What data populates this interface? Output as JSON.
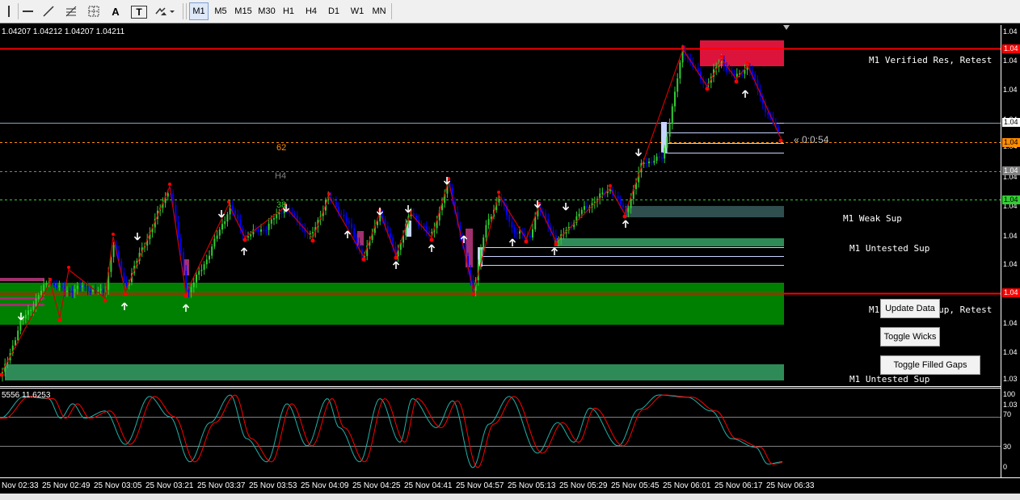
{
  "toolbar": {
    "tools": [
      {
        "icon": "cursor-icon",
        "glyph": "┃"
      },
      {
        "icon": "horizontal-line-icon",
        "glyph": "—"
      },
      {
        "icon": "trendline-icon",
        "glyph": "╱"
      },
      {
        "icon": "fibonacci-icon",
        "glyph": "≡"
      },
      {
        "icon": "grid-icon",
        "glyph": "░"
      },
      {
        "icon": "text-icon",
        "glyph": "A"
      },
      {
        "icon": "text-label-icon",
        "glyph": "T"
      },
      {
        "icon": "arrows-dropdown-icon",
        "glyph": "⤧"
      }
    ],
    "timeframes": [
      "M1",
      "M5",
      "M15",
      "M30",
      "H1",
      "H4",
      "D1",
      "W1",
      "MN"
    ],
    "active_timeframe": "M1"
  },
  "chart": {
    "ohlc_text": "1.04207 1.04212 1.04207 1.04211",
    "countdown": "« 0:0:54",
    "fib_label_62": "62",
    "fib_label_h4": "H4",
    "fib_label_38": "38",
    "zone_labels": {
      "verified_res": "M1 Verified Res, Retest",
      "weak_sup": "M1 Weak Sup",
      "untested_sup_1": "M1 Untested Sup",
      "verified_sup": "M1 Verified Sup, Retest",
      "untested_sup_2": "M1 Untested Sup"
    },
    "buttons": {
      "update_data": "Update Data",
      "toggle_wicks": "Toggle Wicks",
      "toggle_filled_gaps": "Toggle Filled Gaps"
    },
    "colors": {
      "resistance": "#dc143c",
      "support_verified": "#008000",
      "support_untested": "#2e8b57",
      "weak_support": "#2f4f4f",
      "level_line": "#ff0000",
      "bull_candle": "#32cd32",
      "bear_candle": "#0000ff",
      "zigzag": "#ff0000",
      "stoch_main": "#20b2aa",
      "stoch_signal": "#ff0000"
    }
  },
  "oscillator": {
    "values_text": "5556 11.6253",
    "scale_labels": [
      "100",
      "70",
      "30",
      "0"
    ]
  },
  "price_axis": {
    "labels": [
      "1.04",
      "1.04",
      "1.04",
      "1.04",
      "1.04",
      "1.04",
      "1.04",
      "1.04",
      "1.04",
      "1.04",
      "1.04",
      "1.04",
      "1.03",
      "1.03"
    ],
    "tags": {
      "red_top": "1.04",
      "current": "1.04",
      "orange": "1.04",
      "gray": "1.04",
      "green": "1.04",
      "red_bottom": "1.04"
    }
  },
  "time_axis": {
    "labels": [
      "Nov 02:33",
      "25 Nov 02:49",
      "25 Nov 03:05",
      "25 Nov 03:21",
      "25 Nov 03:37",
      "25 Nov 03:53",
      "25 Nov 04:09",
      "25 Nov 04:25",
      "25 Nov 04:41",
      "25 Nov 04:57",
      "25 Nov 05:13",
      "25 Nov 05:29",
      "25 Nov 05:45",
      "25 Nov 06:01",
      "25 Nov 06:17",
      "25 Nov 06:33"
    ]
  }
}
